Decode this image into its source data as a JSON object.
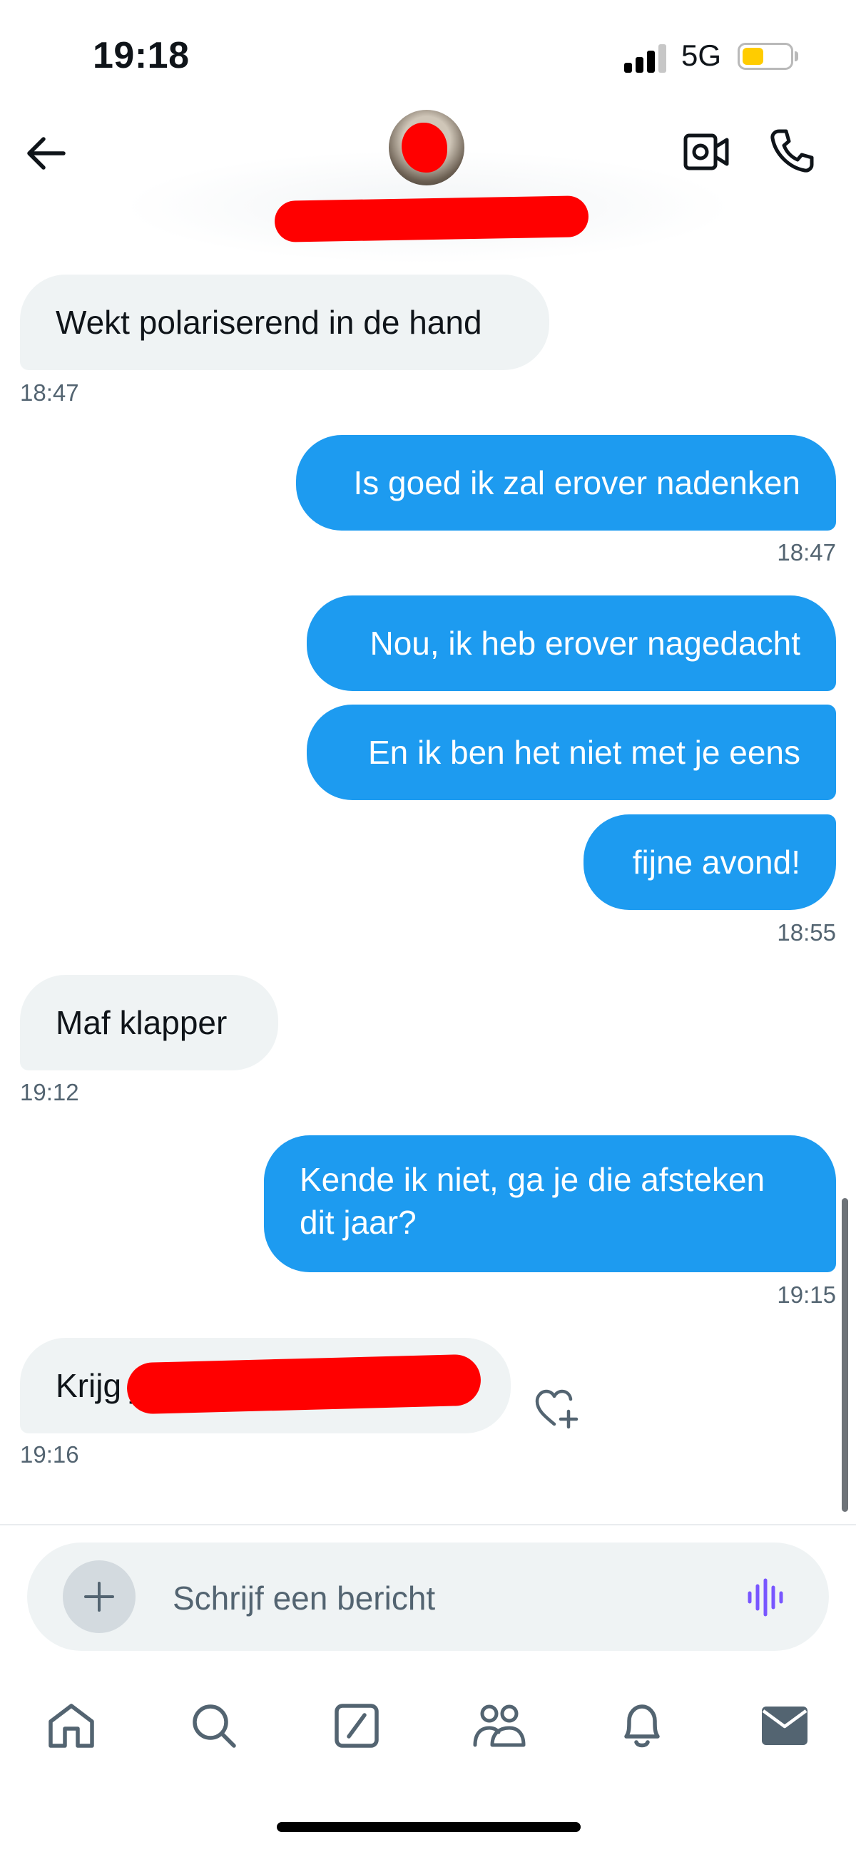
{
  "status_bar": {
    "time": "19:18",
    "network": "5G",
    "battery_level": 0.45,
    "battery_color": "#ffcc00",
    "signal_bars": 3
  },
  "header": {
    "back_icon": "arrow-left-icon",
    "video_icon": "video-camera-icon",
    "call_icon": "phone-icon"
  },
  "messages": [
    {
      "direction": "received",
      "text": "Wekt polariserend in de hand",
      "time": "18:47"
    },
    {
      "direction": "sent",
      "text": "Is goed ik zal erover nadenken",
      "time": "18:47"
    },
    {
      "direction": "sent",
      "text": "Nou, ik heb erover nagedacht"
    },
    {
      "direction": "sent",
      "text": "En ik ben het niet met je eens"
    },
    {
      "direction": "sent",
      "text": "fijne avond!",
      "time": "18:55"
    },
    {
      "direction": "received",
      "text": "Maf klapper",
      "time": "19:12"
    },
    {
      "direction": "sent",
      "text_line1": "Kende ik niet, ga je die afsteken",
      "text_line2": "dit jaar?",
      "time": "19:15"
    },
    {
      "direction": "received",
      "text": "Krijg j",
      "time": "19:16",
      "redacted": true
    }
  ],
  "composer": {
    "placeholder": "Schrijf een bericht",
    "add_icon": "plus-icon",
    "voice_icon": "voice-wave-icon"
  },
  "nav": [
    {
      "icon": "home-icon"
    },
    {
      "icon": "search-icon"
    },
    {
      "icon": "grok-icon"
    },
    {
      "icon": "communities-icon"
    },
    {
      "icon": "bell-icon"
    },
    {
      "icon": "mail-icon"
    }
  ],
  "colors": {
    "sent_bubble": "#1d9bf0",
    "received_bubble": "#eff3f4",
    "timestamp": "#536471",
    "redaction": "#ff0000",
    "voice_icon": "#7856ff"
  }
}
